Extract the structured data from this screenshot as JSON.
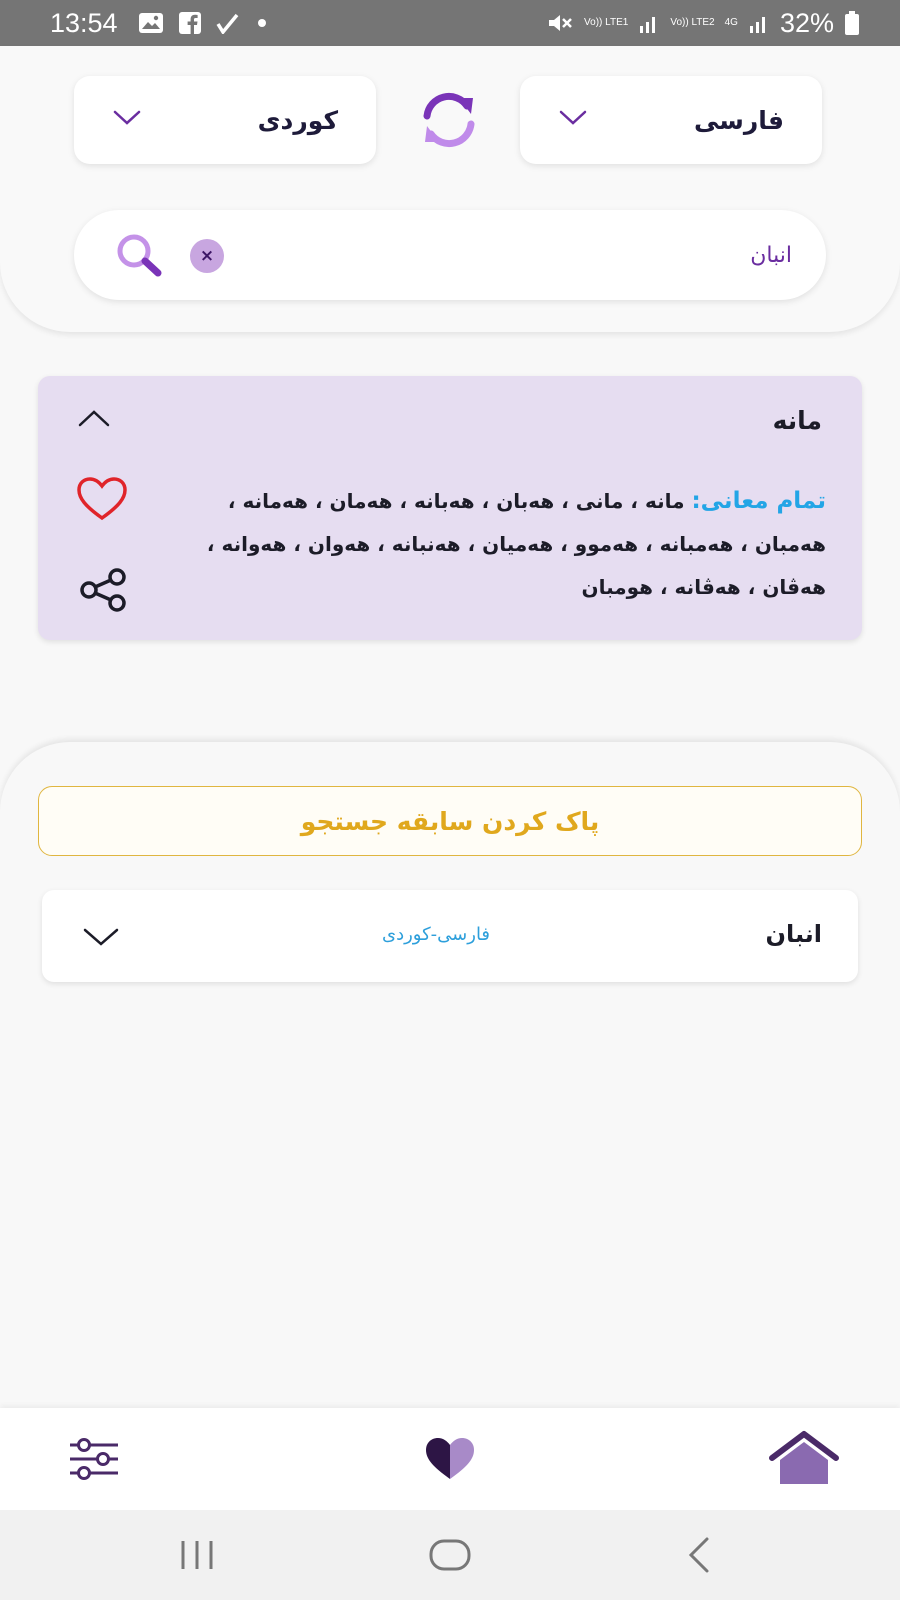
{
  "status_bar": {
    "time": "13:54",
    "battery": "32%",
    "sim1": "Vo)) LTE1",
    "sim2": "Vo)) LTE2",
    "network": "4G"
  },
  "languages": {
    "source": "فارسی",
    "target": "کوردی"
  },
  "search": {
    "value": "انبان",
    "clear_label": "×"
  },
  "result": {
    "word": "مانه",
    "meanings_label": "تمام معانی:",
    "meanings_text": "مانه ، مانی ، هه‌بان ، هه‌بانه ، هه‌مان ، هه‌مانه ، هه‌مبان ، هه‌مبانه ، هه‌موو ، هه‌میان ، هه‌نبانه ، هه‌وان ، هه‌وانه ، هه‌ڤان ، هه‌ڤانه ، هومبان"
  },
  "history": {
    "clear_label": "پاک کردن سابقه جستجو",
    "items": [
      {
        "word": "انبان",
        "pair": "فارسی-کوردی"
      }
    ]
  },
  "colors": {
    "accent_purple": "#6a2da0",
    "light_purple": "#b58ad8",
    "card_bg": "#e6ddf1",
    "link_blue": "#23a5e6",
    "warning_yellow": "#e0a81d",
    "heart_red": "#e0242a"
  },
  "icons": {
    "swap": "swap-icon",
    "search": "search-icon",
    "favorite": "heart-icon",
    "share": "share-icon",
    "settings": "sliders-icon",
    "home": "home-icon"
  }
}
